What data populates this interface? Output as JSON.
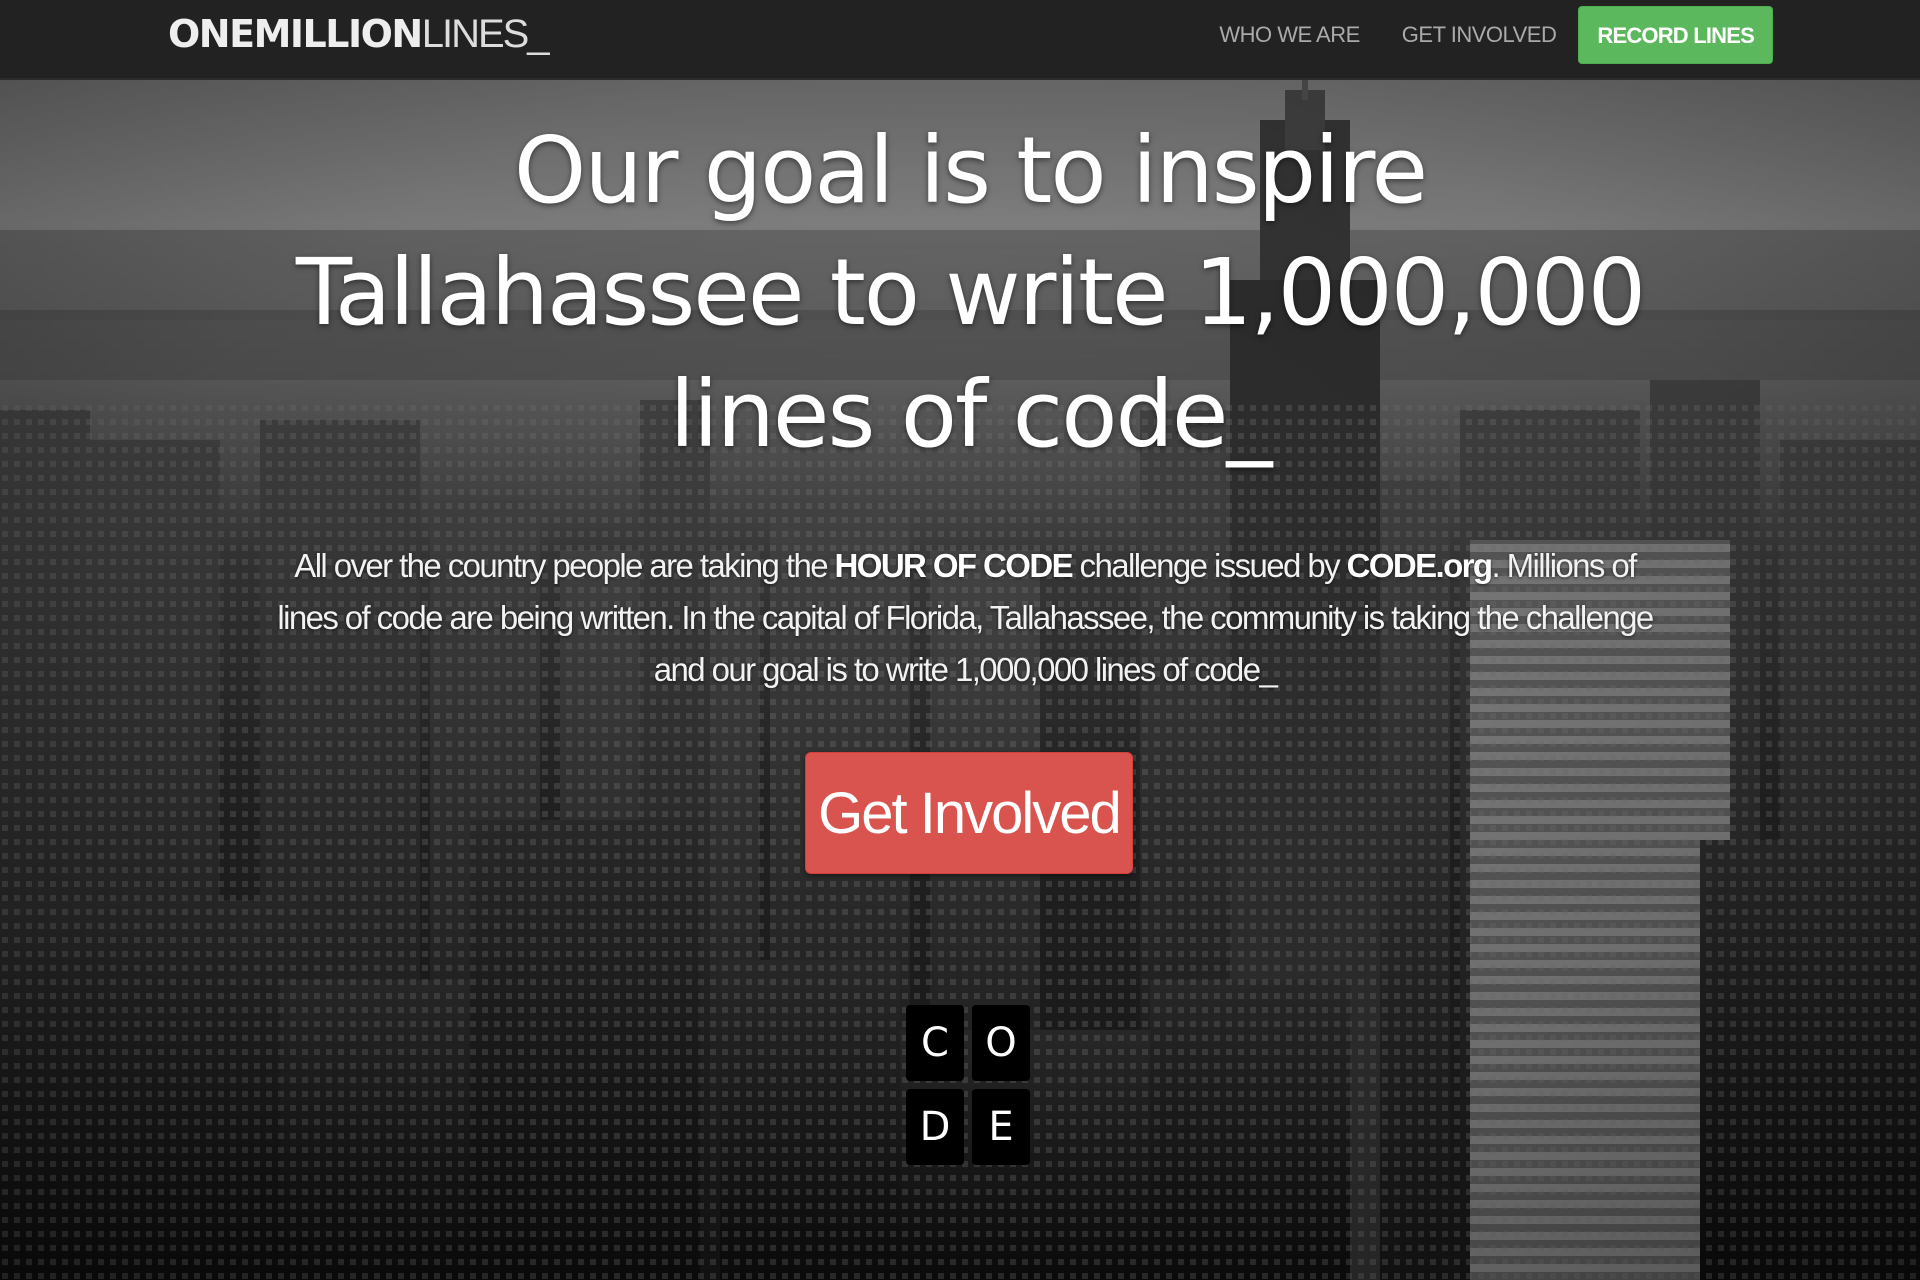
{
  "navbar": {
    "brand_bold": "ONEMILLION",
    "brand_thin": "LINES_",
    "links": [
      {
        "label": "WHO WE ARE"
      },
      {
        "label": "GET INVOLVED"
      }
    ],
    "record_button": "RECORD LINES",
    "record_color": "#5cb85c"
  },
  "hero": {
    "headline_line1": "Our goal is to inspire",
    "headline_line2": "Tallahassee to write 1,000,000",
    "headline_line3": "lines of code_",
    "lead_part1": "All over the country people are taking the ",
    "lead_bold1": "HOUR OF CODE",
    "lead_part2": " challenge issued by ",
    "lead_bold2": "CODE.org",
    "lead_part3": ". Millions of lines of code are being written. In the capital of Florida, Tallahassee, the community is taking the challenge and our goal is to write 1,000,000 lines of code_",
    "cta_label": "Get Involved",
    "cta_color": "#d9534f"
  },
  "code_logo": {
    "letters": [
      "C",
      "O",
      "D",
      "E"
    ]
  }
}
